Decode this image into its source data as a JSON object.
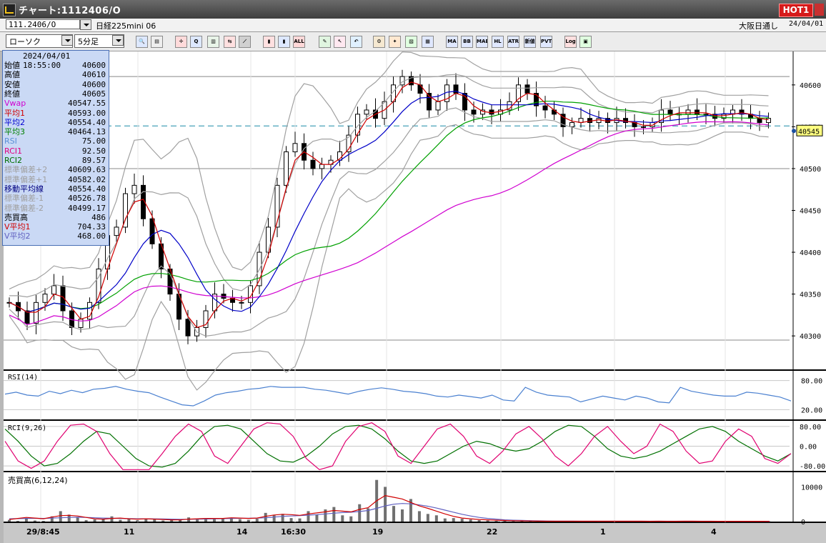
{
  "window": {
    "title": "チャート:1112406/O",
    "hot_label": "HOT1"
  },
  "infobar": {
    "symbol_code": "111.2406/O",
    "symbol_name": "日経225mini 06",
    "session": "大阪日通し",
    "date": "24/04/01"
  },
  "toolbar": {
    "chart_type": "ローソク",
    "interval": "5分足",
    "buttons": [
      {
        "name": "zoom-icon",
        "label": "🔍",
        "bg": "#dde8ff"
      },
      {
        "name": "split-icon",
        "label": "▤",
        "bg": "#eeeeee"
      },
      {
        "name": "crosshair-icon",
        "label": "✛",
        "bg": "#ffdada"
      },
      {
        "name": "magnify-icon",
        "label": "Q",
        "bg": "#dde8ff"
      },
      {
        "name": "bar-chart-icon",
        "label": "▥",
        "bg": "#e8f4e8"
      },
      {
        "name": "swap-icon",
        "label": "⇆",
        "bg": "#ffe0e0"
      },
      {
        "name": "ruler-icon",
        "label": "⟋",
        "bg": "#d0d0d0"
      },
      {
        "name": "candle-red-icon",
        "label": "▮",
        "bg": "#ffe0e0"
      },
      {
        "name": "candle-blue-icon",
        "label": "▮",
        "bg": "#dde8ff"
      },
      {
        "name": "all-icon",
        "label": "ALL",
        "bg": "#ffd8d8"
      },
      {
        "name": "pencil-icon",
        "label": "✎",
        "bg": "#e0f5e0"
      },
      {
        "name": "cursor-icon",
        "label": "↖",
        "bg": "#ffe8f0"
      },
      {
        "name": "back-icon",
        "label": "↶",
        "bg": "#e0f0ff"
      },
      {
        "name": "gear-icon",
        "label": "⚙",
        "bg": "#f5e8d0"
      },
      {
        "name": "wrench-icon",
        "label": "✦",
        "bg": "#ffe8d0"
      },
      {
        "name": "palette-icon",
        "label": "▧",
        "bg": "#e0ffe0"
      },
      {
        "name": "grid-icon",
        "label": "▦",
        "bg": "#e0e8ff"
      },
      {
        "name": "ma-icon",
        "label": "MA",
        "bg": "#e0e8ff"
      },
      {
        "name": "bb-icon",
        "label": "BB",
        "bg": "#e0e8ff"
      },
      {
        "name": "mae-icon",
        "label": "MAE",
        "bg": "#e0e8ff"
      },
      {
        "name": "hl-icon",
        "label": "HL",
        "bg": "#e0e8ff"
      },
      {
        "name": "atr-icon",
        "label": "ATR",
        "bg": "#e0e8ff"
      },
      {
        "name": "kagi-icon",
        "label": "新値",
        "bg": "#e0e8ff"
      },
      {
        "name": "pvt-icon",
        "label": "PVT",
        "bg": "#e0e8ff"
      },
      {
        "name": "log-icon",
        "label": "Log",
        "bg": "#ffe0e0"
      },
      {
        "name": "window-icon",
        "label": "▣",
        "bg": "#e0ffe0"
      }
    ]
  },
  "infopanel": {
    "datetime": "2024/04/01 18:55:00",
    "rows": [
      {
        "label": "始値",
        "value": "40600",
        "color": "#000000"
      },
      {
        "label": "高値",
        "value": "40610",
        "color": "#000000"
      },
      {
        "label": "安値",
        "value": "40600",
        "color": "#000000"
      },
      {
        "label": "終値",
        "value": "40605",
        "color": "#000000"
      },
      {
        "label": "Vwap",
        "value": "40547.55",
        "color": "#d000d0"
      },
      {
        "label": "平均1",
        "value": "40593.00",
        "color": "#d00000"
      },
      {
        "label": "平均2",
        "value": "40554.40",
        "color": "#0000d0"
      },
      {
        "label": "平均3",
        "value": "40464.13",
        "color": "#008000"
      },
      {
        "label": "RSI",
        "value": "75.00",
        "color": "#5a8fd6"
      },
      {
        "label": "RCI1",
        "value": "92.50",
        "color": "#e00080"
      },
      {
        "label": "RCI2",
        "value": "89.57",
        "color": "#007000"
      },
      {
        "label": "標準偏差+2",
        "value": "40609.63",
        "color": "#a0a0a0"
      },
      {
        "label": "標準偏差+1",
        "value": "40582.02",
        "color": "#a0a0a0"
      },
      {
        "label": "移動平均線",
        "value": "40554.40",
        "color": "#000080"
      },
      {
        "label": "標準偏差-1",
        "value": "40526.78",
        "color": "#a0a0a0"
      },
      {
        "label": "標準偏差-2",
        "value": "40499.17",
        "color": "#a0a0a0"
      },
      {
        "label": "売買高",
        "value": "486",
        "color": "#000000"
      },
      {
        "label": "V平均1",
        "value": "704.33",
        "color": "#d00000"
      },
      {
        "label": "V平均2",
        "value": "468.00",
        "color": "#6060c0"
      }
    ]
  },
  "chart_data": {
    "type": "line",
    "x_labels": [
      "29/8:45",
      "11",
      "14",
      "16:30",
      "19",
      "22",
      "1",
      "4"
    ],
    "price_axis": {
      "ticks": [
        "40600",
        "40550",
        "40500",
        "40450",
        "40400",
        "40350",
        "40300"
      ],
      "ylim": [
        40260,
        40640
      ],
      "current_price": "40545"
    },
    "colors": {
      "candle": "#000000",
      "avg1": "#d00000",
      "avg2": "#0000c8",
      "avg3": "#00a000",
      "vwap": "#d000d0",
      "band": "#a0a0a0",
      "rsi": "#4a80d0",
      "rci1": "#e00070",
      "rci2": "#007000",
      "vol": "#707070"
    },
    "price_summary": {
      "open": 40600,
      "high": 40610,
      "low": 40600,
      "close": 40605,
      "vwap": 40547.55,
      "avg1": 40593.0,
      "avg2": 40554.4,
      "avg3": 40464.13,
      "bb_plus2": 40609.63,
      "bb_plus1": 40582.02,
      "bb_mid": 40554.4,
      "bb_minus1": 40526.78,
      "bb_minus2": 40499.17
    },
    "price_path": [
      40340,
      40330,
      40315,
      40340,
      40350,
      40360,
      40330,
      40310,
      40320,
      40340,
      40380,
      40420,
      40430,
      40470,
      40480,
      40440,
      40410,
      40380,
      40350,
      40320,
      40300,
      40310,
      40330,
      40350,
      40345,
      40340,
      40340,
      40360,
      40400,
      40430,
      40480,
      40520,
      40530,
      40510,
      40500,
      40505,
      40510,
      40520,
      40540,
      40565,
      40570,
      40560,
      40580,
      40600,
      40610,
      40600,
      40590,
      40570,
      40580,
      40600,
      40590,
      40570,
      40565,
      40570,
      40565,
      40570,
      40580,
      40600,
      40590,
      40575,
      40570,
      40565,
      40550,
      40555,
      40560,
      40555,
      40560,
      40555,
      40560,
      40555,
      40550,
      40550,
      40555,
      40570,
      40565,
      40565,
      40570,
      40565,
      40565,
      40560,
      40565,
      40570,
      40565,
      40560,
      40555,
      40560
    ],
    "rsi": {
      "label": "RSI(14)",
      "ticks": [
        "80.00",
        "20.00"
      ],
      "ylim": [
        0,
        100
      ],
      "values": [
        52,
        56,
        50,
        48,
        58,
        53,
        60,
        55,
        62,
        64,
        68,
        62,
        58,
        55,
        46,
        38,
        30,
        28,
        38,
        50,
        55,
        58,
        62,
        64,
        68,
        66,
        66,
        66,
        62,
        60,
        56,
        52,
        58,
        62,
        65,
        62,
        58,
        56,
        53,
        48,
        46,
        50,
        47,
        44,
        50,
        40,
        38,
        66,
        56,
        50,
        48,
        46,
        36,
        42,
        48,
        44,
        40,
        48,
        44,
        36,
        34,
        66,
        58,
        54,
        50,
        48,
        48,
        56,
        54,
        50,
        46,
        38
      ]
    },
    "rci": {
      "label": "RCI(9,26)",
      "ticks": [
        "80.00",
        "0.00",
        "-80.00"
      ],
      "ylim": [
        -100,
        100
      ],
      "rci1": [
        20,
        -60,
        -90,
        -60,
        20,
        85,
        90,
        60,
        -30,
        -95,
        -95,
        -95,
        -30,
        40,
        90,
        60,
        -40,
        -70,
        0,
        70,
        95,
        90,
        40,
        -50,
        -95,
        -80,
        20,
        80,
        95,
        60,
        -40,
        -70,
        0,
        70,
        90,
        40,
        -40,
        -70,
        -20,
        50,
        80,
        30,
        -40,
        -80,
        -30,
        40,
        80,
        20,
        -30,
        0,
        90,
        60,
        -20,
        -70,
        -60,
        20,
        70,
        40,
        -50,
        -70,
        -30
      ],
      "rci2": [
        70,
        20,
        -40,
        -80,
        -70,
        -30,
        20,
        60,
        50,
        0,
        -50,
        -80,
        -85,
        -70,
        -20,
        40,
        80,
        85,
        70,
        20,
        -30,
        -60,
        -65,
        -40,
        0,
        50,
        80,
        85,
        70,
        30,
        -20,
        -60,
        -70,
        -60,
        -30,
        0,
        20,
        10,
        -10,
        -20,
        -10,
        20,
        60,
        85,
        80,
        40,
        -10,
        -40,
        -50,
        -40,
        -20,
        10,
        40,
        70,
        80,
        60,
        20,
        -10,
        -40,
        -60,
        -30
      ]
    },
    "volume": {
      "label": "売買高(6,12,24)",
      "ticks": [
        "10000",
        "0"
      ],
      "ylim": [
        0,
        14000
      ],
      "bars": [
        500,
        200,
        900,
        300,
        200,
        1500,
        3000,
        2000,
        1200,
        400,
        600,
        800,
        1500,
        500,
        700,
        400,
        900,
        600,
        300,
        500,
        400,
        1200,
        600,
        800,
        700,
        900,
        1000,
        700,
        500,
        800,
        2500,
        1800,
        2200,
        1000,
        900,
        3000,
        2000,
        3500,
        4200,
        1800,
        1500,
        5000,
        3800,
        12000,
        10000,
        4500,
        3500,
        6500,
        3000,
        2200,
        1800,
        900,
        1000,
        800,
        600,
        400,
        300,
        200,
        300,
        150,
        200,
        100,
        150,
        100,
        120,
        100,
        150,
        100,
        100,
        80,
        120,
        100,
        150,
        100,
        100,
        80,
        100,
        80,
        100,
        120,
        100,
        90,
        100,
        80,
        100,
        90,
        80,
        100,
        80,
        60
      ],
      "ma1": [
        600,
        900,
        1200,
        1000,
        800,
        1300,
        1700,
        1800,
        1600,
        1200,
        800,
        700,
        900,
        1000,
        800,
        700,
        800,
        700,
        600,
        500,
        500,
        700,
        800,
        900,
        900,
        900,
        1100,
        1000,
        900,
        1000,
        1500,
        1900,
        2100,
        2000,
        1800,
        2200,
        2500,
        2800,
        3200,
        3000,
        2800,
        3500,
        4000,
        6000,
        7500,
        7000,
        6500,
        5500,
        4500,
        3800,
        3000,
        2200,
        1500,
        1000,
        800,
        600,
        500,
        400,
        300,
        250,
        200,
        160,
        130,
        110,
        110,
        100,
        110,
        100,
        100,
        100,
        100,
        100,
        110,
        100,
        100,
        90,
        100,
        90,
        90,
        100,
        100,
        90,
        90,
        90,
        90,
        90,
        90,
        90,
        80,
        70
      ],
      "ma2": [
        800,
        850,
        900,
        950,
        900,
        1000,
        1100,
        1200,
        1250,
        1200,
        1100,
        1000,
        950,
        900,
        850,
        800,
        800,
        780,
        750,
        700,
        650,
        650,
        700,
        750,
        800,
        850,
        900,
        950,
        950,
        1000,
        1100,
        1300,
        1500,
        1600,
        1700,
        1850,
        2000,
        2200,
        2400,
        2600,
        2700,
        2900,
        3200,
        3800,
        4500,
        5000,
        5200,
        5100,
        4800,
        4400,
        3900,
        3300,
        2700,
        2100,
        1600,
        1200,
        900,
        700,
        500,
        400,
        320,
        260,
        200,
        170,
        150,
        130,
        120,
        110,
        105,
        100,
        100,
        100,
        100,
        100,
        100,
        95,
        95,
        95,
        95,
        95,
        95,
        95,
        95,
        90,
        90,
        90,
        90,
        90,
        85,
        80
      ]
    }
  }
}
